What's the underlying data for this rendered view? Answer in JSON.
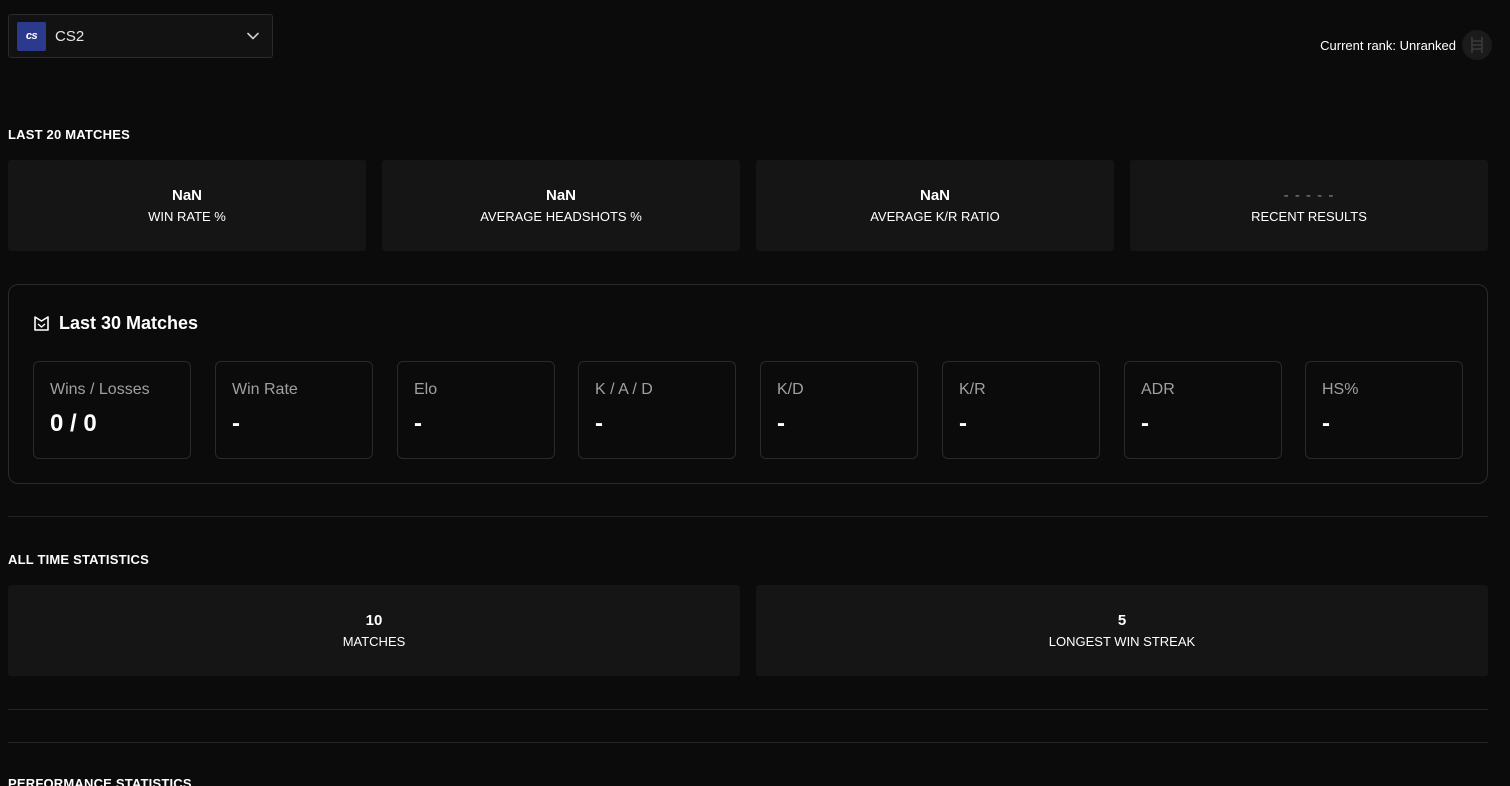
{
  "game_selector": {
    "logo_text": "cs",
    "game": "CS2"
  },
  "rank": {
    "label": "Current rank: Unranked"
  },
  "last20": {
    "title": "LAST 20 MATCHES",
    "cards": [
      {
        "value": "NaN",
        "label": "WIN RATE %"
      },
      {
        "value": "NaN",
        "label": "AVERAGE HEADSHOTS %"
      },
      {
        "value": "NaN",
        "label": "AVERAGE K/R RATIO"
      },
      {
        "value": "- - - - -",
        "label": "RECENT RESULTS"
      }
    ]
  },
  "last30": {
    "title": "Last 30 Matches",
    "stats": [
      {
        "label": "Wins / Losses",
        "value": "0 / 0"
      },
      {
        "label": "Win Rate",
        "value": "-"
      },
      {
        "label": "Elo",
        "value": "-"
      },
      {
        "label": "K / A / D",
        "value": "-"
      },
      {
        "label": "K/D",
        "value": "-"
      },
      {
        "label": "K/R",
        "value": "-"
      },
      {
        "label": "ADR",
        "value": "-"
      },
      {
        "label": "HS%",
        "value": "-"
      }
    ]
  },
  "all_time": {
    "title": "ALL TIME STATISTICS",
    "cards": [
      {
        "value": "10",
        "label": "MATCHES"
      },
      {
        "value": "5",
        "label": "LONGEST WIN STREAK"
      }
    ]
  },
  "performance": {
    "title": "PERFORMANCE STATISTICS"
  },
  "icons": {
    "chevron": "chevron-down-icon",
    "rank": "rank-ladder-icon",
    "faceit": "faceit-logo-icon"
  }
}
